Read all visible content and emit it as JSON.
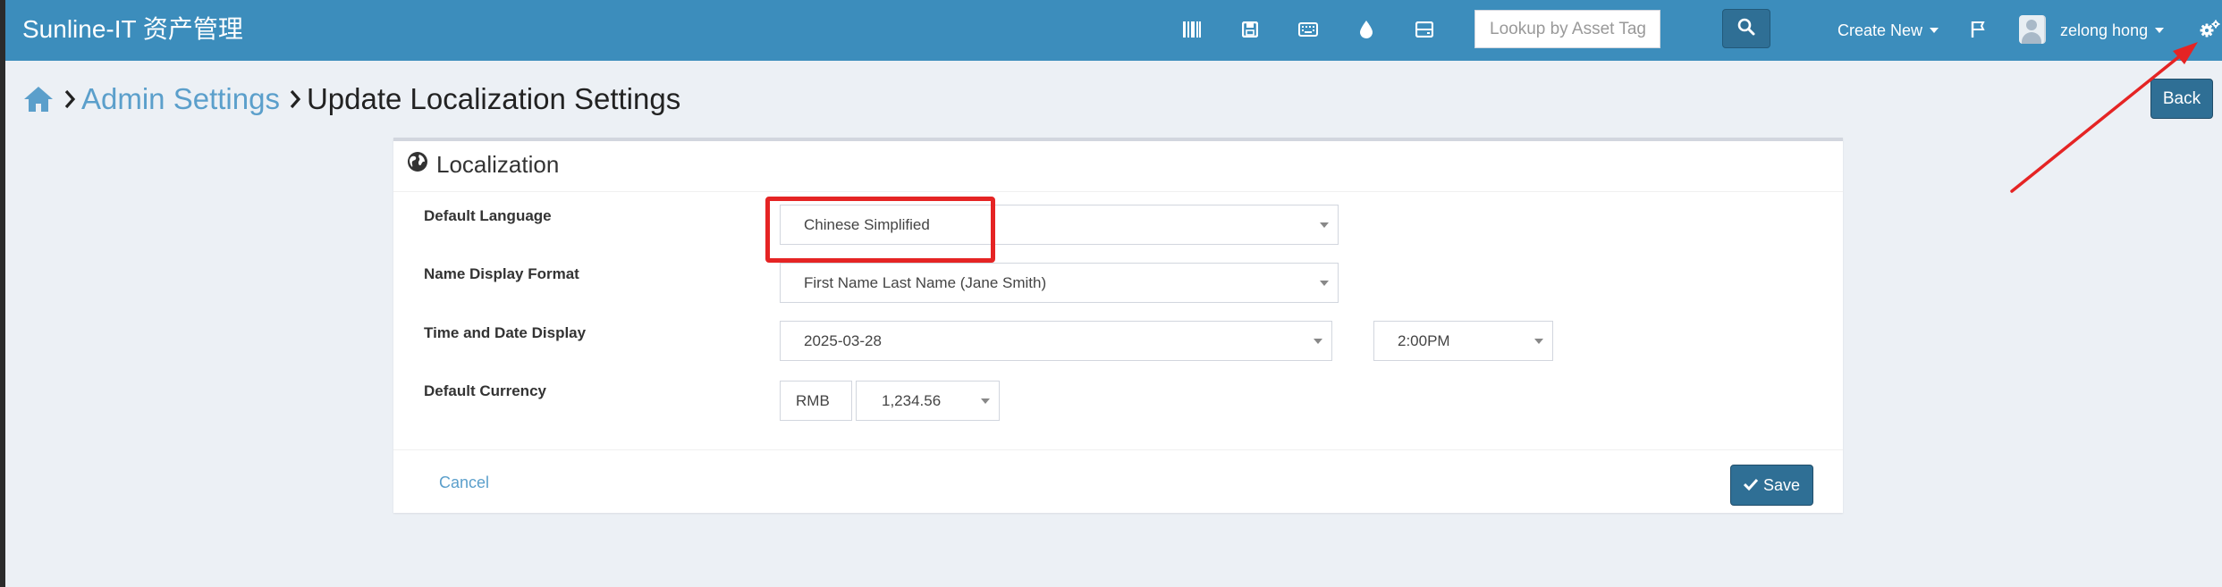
{
  "navbar": {
    "brand": "Sunline-IT 资产管理",
    "icons": [
      "barcode-icon",
      "save-icon",
      "keyboard-icon",
      "tint-icon",
      "hdd-icon"
    ],
    "search_placeholder": "Lookup by Asset Tag",
    "search_icon": "search-icon",
    "create_new": "Create New",
    "flag_icon": "flag-icon",
    "user_name": "zelong hong",
    "settings_icon": "cogs-icon"
  },
  "breadcrumb": {
    "home_icon": "home-icon",
    "admin_settings": "Admin Settings",
    "current": "Update Localization Settings"
  },
  "back_label": "Back",
  "panel": {
    "title": "Localization",
    "title_icon": "globe-icon",
    "fields": {
      "default_language": {
        "label": "Default Language",
        "value": "Chinese Simplified"
      },
      "name_display_format": {
        "label": "Name Display Format",
        "value": "First Name Last Name (Jane Smith)"
      },
      "time_date_display": {
        "label": "Time and Date Display",
        "date_value": "2025-03-28",
        "time_value": "2:00PM"
      },
      "default_currency": {
        "label": "Default Currency",
        "currency_value": "RMB",
        "format_value": "1,234.56"
      }
    },
    "cancel_label": "Cancel",
    "save_label": "Save"
  },
  "colors": {
    "navbar": "#3c8dbc",
    "button": "#2f6f95",
    "link": "#5b9fcb",
    "annotation": "#e52424",
    "background": "#ecf0f5"
  }
}
